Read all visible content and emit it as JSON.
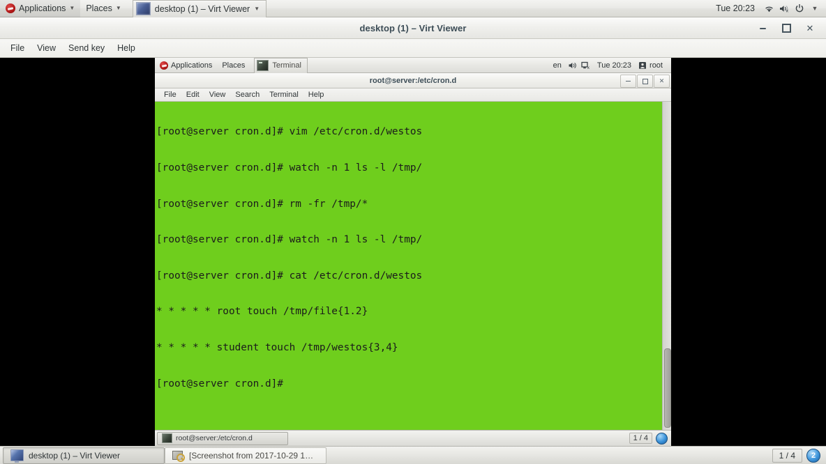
{
  "host_panel": {
    "applications_label": "Applications",
    "places_label": "Places",
    "window_button_label": "desktop (1) – Virt Viewer",
    "clock": "Tue 20:23",
    "icons": [
      "wifi-icon",
      "volume-muted-icon",
      "power-icon",
      "caret-down-icon"
    ]
  },
  "virt_viewer": {
    "title": "desktop (1) – Virt Viewer",
    "menus": [
      "File",
      "View",
      "Send key",
      "Help"
    ],
    "controls": {
      "minimize": "−",
      "maximize": "□",
      "close": "✕"
    }
  },
  "vm_panel": {
    "applications_label": "Applications",
    "places_label": "Places",
    "window_button_label": "Terminal",
    "keyboard_layout": "en",
    "clock": "Tue 20:23",
    "user": "root"
  },
  "terminal": {
    "title": "root@server:/etc/cron.d",
    "menus": [
      "File",
      "Edit",
      "View",
      "Search",
      "Terminal",
      "Help"
    ],
    "background_color": "#6fce1d",
    "foreground_color": "#1b1b1b",
    "lines": [
      "[root@server cron.d]# vim /etc/cron.d/westos",
      "[root@server cron.d]# watch -n 1 ls -l /tmp/",
      "[root@server cron.d]# rm -fr /tmp/*",
      "[root@server cron.d]# watch -n 1 ls -l /tmp/",
      "[root@server cron.d]# cat /etc/cron.d/westos",
      "* * * * * root touch /tmp/file{1.2}",
      "* * * * * student touch /tmp/westos{3,4}",
      "[root@server cron.d]# "
    ]
  },
  "vm_bottom_panel": {
    "task_label": "root@server:/etc/cron.d",
    "workspace": "1 / 4",
    "badge": ""
  },
  "host_bottom_panel": {
    "task_active_label": "desktop (1) – Virt Viewer",
    "task_inactive_label": "[Screenshot from 2017-10-29 1…",
    "workspace": "1 / 4",
    "badge": "2"
  }
}
